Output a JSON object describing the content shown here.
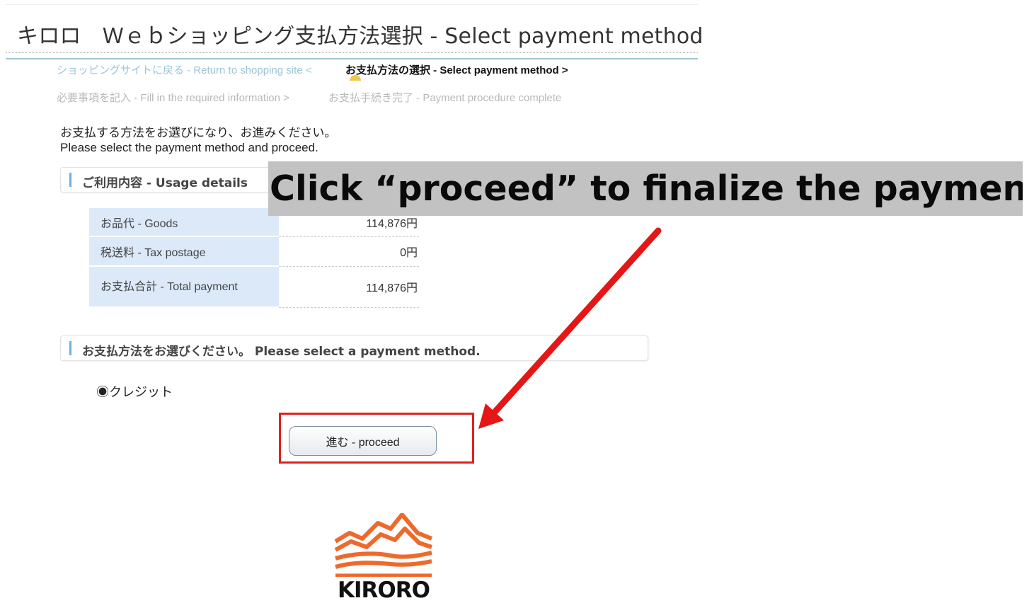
{
  "page": {
    "title": "キロロ　Ｗｅｂショッピング支払方法選択 - Select payment method"
  },
  "breadcrumb": {
    "return_link": "ショッピングサイトに戻る - Return to shopping site <",
    "current_step": "お支払方法の選択 - Select payment method >",
    "step_fill": "必要事項を記入 - Fill in the required information >",
    "step_complete": "お支払手続き完了 - Payment procedure complete"
  },
  "intro": {
    "line_jp": "お支払する方法をお選びになり、お進みください。",
    "line_en": "Please select the payment method and proceed."
  },
  "usage": {
    "heading": "ご利用内容 - Usage details",
    "rows": [
      {
        "label": "お品代 - Goods",
        "value": "114,876円"
      },
      {
        "label": "税送料 - Tax postage",
        "value": "0円"
      },
      {
        "label": "お支払合計 - Total payment",
        "value": "114,876円"
      }
    ]
  },
  "payment_method": {
    "heading": "お支払方法をお選びください。 Please select a payment method.",
    "options": [
      {
        "label": "クレジット",
        "selected": true
      }
    ]
  },
  "proceed_button": {
    "label": "進む - proceed"
  },
  "annotation": {
    "callout_text": "Click “proceed” to finalize the payment",
    "highlight_color": "#e02020"
  },
  "logo": {
    "text": "KIRORO",
    "accent_color": "#ee6a2c"
  }
}
